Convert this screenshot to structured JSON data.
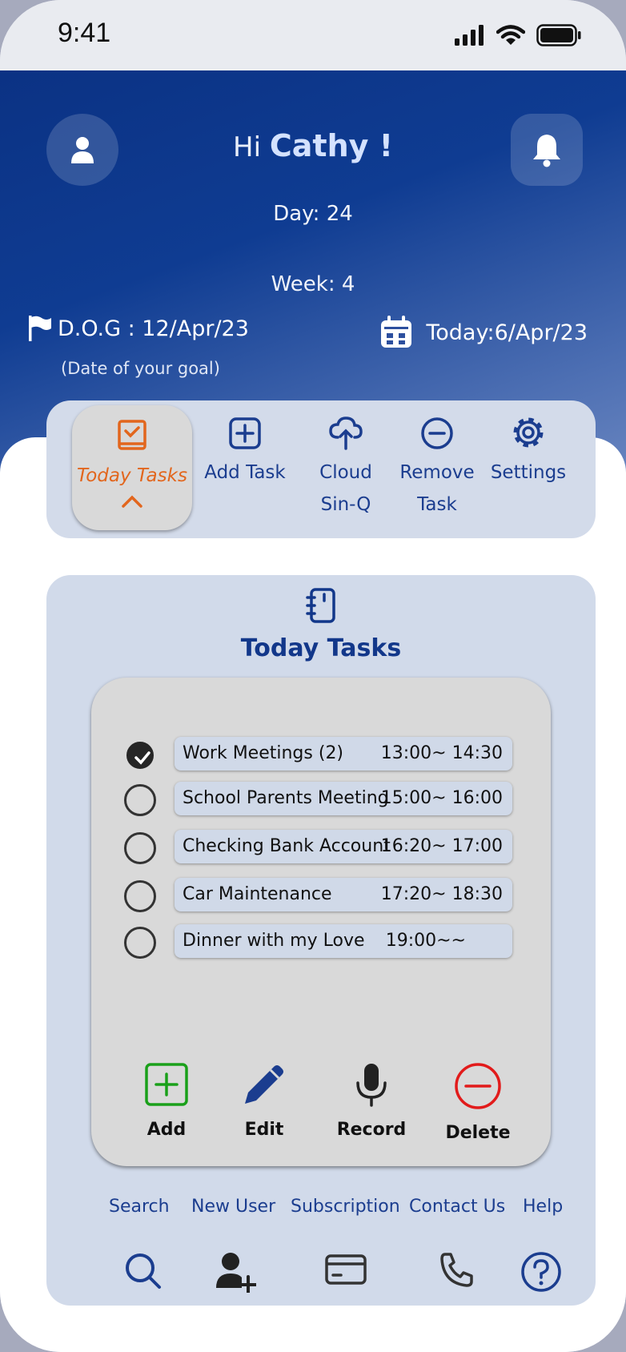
{
  "status_bar": {
    "time": "9:41"
  },
  "header": {
    "greeting_prefix": "Hi",
    "user_name": "Cathy !",
    "day": "Day: 24",
    "week": "Week: 4",
    "goal_date": "D.O.G : 12/Apr/23",
    "goal_note": "(Date of your goal)",
    "today": "Today:6/Apr/23"
  },
  "nav": [
    {
      "label": "Today Tasks",
      "icon": "book-check-icon",
      "active": true
    },
    {
      "label": "Add Task",
      "icon": "plus-square-icon"
    },
    {
      "label": "Cloud",
      "label2": "Sin-Q",
      "icon": "cloud-upload-icon"
    },
    {
      "label": "Remove",
      "label2": "Task",
      "icon": "minus-circle-icon"
    },
    {
      "label": "Settings",
      "icon": "gear-icon"
    }
  ],
  "panel": {
    "title": "Today Tasks",
    "tasks": [
      {
        "name": "Work Meetings (2)",
        "time": "13:00~ 14:30",
        "done": true
      },
      {
        "name": "School Parents Meeting",
        "time": "15:00~ 16:00",
        "done": false
      },
      {
        "name": "Checking Bank Account",
        "time": "16:20~ 17:00",
        "done": false
      },
      {
        "name": "Car Maintenance",
        "time": "17:20~ 18:30",
        "done": false
      },
      {
        "name": "Dinner with my Love",
        "time": "19:00~~",
        "done": false
      }
    ],
    "actions": [
      {
        "label": "Add",
        "icon": "add-square-icon",
        "color": "#1aa01a"
      },
      {
        "label": "Edit",
        "icon": "pencil-icon",
        "color": "#1b3d8f"
      },
      {
        "label": "Record",
        "icon": "microphone-icon",
        "color": "#222222"
      },
      {
        "label": "Delete",
        "icon": "minus-circle-icon",
        "color": "#e21b1b"
      }
    ]
  },
  "bottom_links": [
    {
      "label": "Search",
      "icon": "search-icon"
    },
    {
      "label": "New User",
      "icon": "add-user-icon"
    },
    {
      "label": "Subscription",
      "icon": "credit-card-icon"
    },
    {
      "label": "Contact Us",
      "icon": "phone-icon"
    },
    {
      "label": "Help",
      "icon": "help-circle-icon"
    }
  ],
  "colors": {
    "accent": "#12378a",
    "active": "#e2661d"
  }
}
